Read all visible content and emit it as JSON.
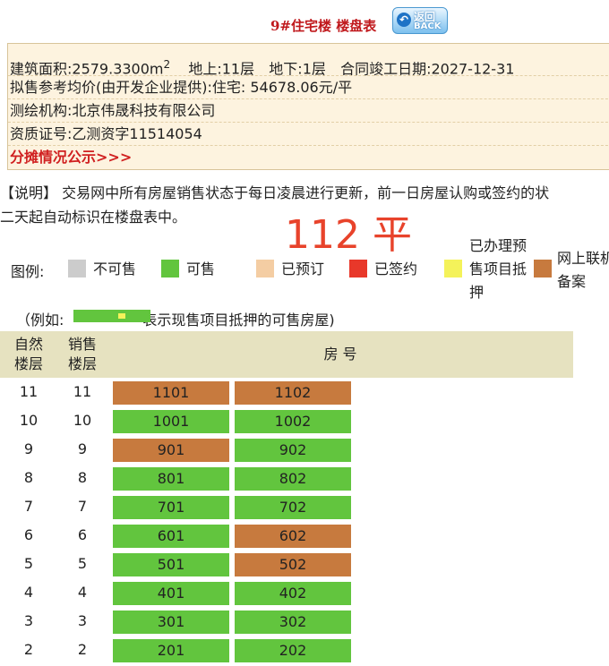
{
  "header": {
    "title": "9#住宅楼 楼盘表",
    "back_cn": "返回",
    "back_en": "BACK"
  },
  "info": {
    "area_label": "建筑面积:2579.3300m",
    "area_sup": "2",
    "floors_above": "地上:11层",
    "floors_below": "地下:1层",
    "completion": "合同竣工日期:2027-12-31",
    "avg_price": "拟售参考均价(由开发企业提供):住宅: 54678.06元/平",
    "survey_org": "测绘机构:北京伟晟科技有限公司",
    "cert_no": "资质证号:乙测资字11514054",
    "share_link": "分摊情况公示>>>"
  },
  "note": {
    "line1": "【说明】 交易网中所有房屋销售状态于每日凌晨进行更新，前一日房屋认购或签约的状",
    "line2": "二天起自动标识在楼盘表中。"
  },
  "overlay": "112 平",
  "legend": {
    "label": "图例:",
    "items": [
      {
        "text": "不可售",
        "color": "#cccccc"
      },
      {
        "text": "可售",
        "color": "#62c53e"
      },
      {
        "text": "已预订",
        "color": "#f4cda3"
      },
      {
        "text": "已签约",
        "color": "#e8382a"
      },
      {
        "text_l1": "已办理预",
        "text_l2": "售项目抵",
        "text_l3": "押",
        "color": "#f4f25a"
      },
      {
        "text_l1": "网上联机",
        "text_l2": "备案",
        "color": "#c77a3e"
      }
    ]
  },
  "example": {
    "prefix": "（例如:",
    "suffix": "表示现售项目抵押的可售房屋)"
  },
  "table": {
    "col_natural": [
      "自然",
      "楼层"
    ],
    "col_sales": [
      "销售",
      "楼层"
    ],
    "col_rooms": "房 号",
    "rows": [
      {
        "natural": "11",
        "sales": "11",
        "units": [
          {
            "no": "1101",
            "status": "网上联机备案"
          },
          {
            "no": "1102",
            "status": "网上联机备案"
          }
        ]
      },
      {
        "natural": "10",
        "sales": "10",
        "units": [
          {
            "no": "1001",
            "status": "可售"
          },
          {
            "no": "1002",
            "status": "可售"
          }
        ]
      },
      {
        "natural": "9",
        "sales": "9",
        "units": [
          {
            "no": "901",
            "status": "网上联机备案"
          },
          {
            "no": "902",
            "status": "可售"
          }
        ]
      },
      {
        "natural": "8",
        "sales": "8",
        "units": [
          {
            "no": "801",
            "status": "可售"
          },
          {
            "no": "802",
            "status": "可售"
          }
        ]
      },
      {
        "natural": "7",
        "sales": "7",
        "units": [
          {
            "no": "701",
            "status": "可售"
          },
          {
            "no": "702",
            "status": "可售"
          }
        ]
      },
      {
        "natural": "6",
        "sales": "6",
        "units": [
          {
            "no": "601",
            "status": "可售"
          },
          {
            "no": "602",
            "status": "网上联机备案"
          }
        ]
      },
      {
        "natural": "5",
        "sales": "5",
        "units": [
          {
            "no": "501",
            "status": "可售"
          },
          {
            "no": "502",
            "status": "网上联机备案"
          }
        ]
      },
      {
        "natural": "4",
        "sales": "4",
        "units": [
          {
            "no": "401",
            "status": "可售"
          },
          {
            "no": "402",
            "status": "可售"
          }
        ]
      },
      {
        "natural": "3",
        "sales": "3",
        "units": [
          {
            "no": "301",
            "status": "可售"
          },
          {
            "no": "302",
            "status": "可售"
          }
        ]
      },
      {
        "natural": "2",
        "sales": "2",
        "units": [
          {
            "no": "201",
            "status": "可售"
          },
          {
            "no": "202",
            "status": "可售"
          }
        ]
      }
    ]
  }
}
